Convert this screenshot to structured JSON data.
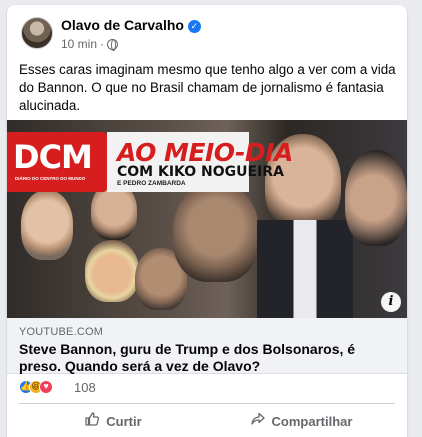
{
  "post": {
    "author": "Olavo de Carvalho",
    "verified_icon": "verified-check-icon",
    "time": "10 min",
    "separator": "·",
    "privacy_icon": "globe-icon",
    "text": "Esses caras imaginam mesmo que tenho algo a ver com a vida do Bannon. O que no Brasil chamam de jornalismo é fantasia alucinada."
  },
  "media": {
    "logo": "DCM",
    "logo_subtitle": "DIÁRIO DO CENTRO DO MUNDO",
    "show_title": "AO MEIO-DIA",
    "show_host": "COM KIKO NOGUEIRA",
    "show_cohost": "E PEDRO ZAMBARDA",
    "info_icon": "info-icon",
    "info_glyph": "i",
    "accent_color": "#d71e1e"
  },
  "link": {
    "domain": "YOUTUBE.COM",
    "title": "Steve Bannon, guru de Trump e dos Bolsonaros, é preso. Quando será a vez de Olavo?"
  },
  "reactions": {
    "icons": [
      "like-icon",
      "haha-icon",
      "love-icon"
    ],
    "count": "108"
  },
  "actions": {
    "like_label": "Curtir",
    "share_label": "Compartilhar"
  },
  "colors": {
    "brand_blue": "#1877f2",
    "muted_text": "#65676b"
  }
}
